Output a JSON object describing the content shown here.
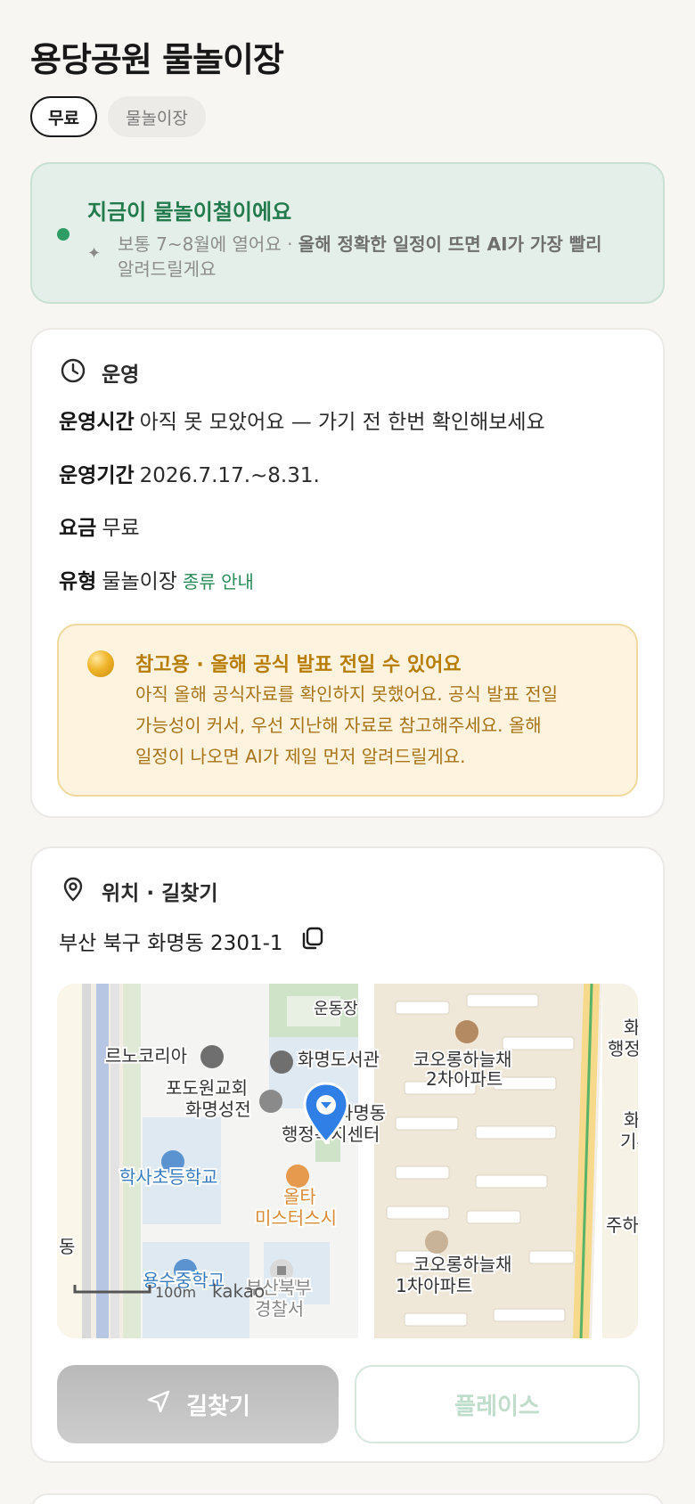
{
  "header": {
    "title": "용당공원 물놀이장"
  },
  "chips": [
    {
      "label": "무료",
      "active": true
    },
    {
      "label": "물놀이장",
      "active": false
    }
  ],
  "season_banner": {
    "headline": "지금이 물놀이철이에요",
    "desc_plain": "보통 7~8월에 열어요 · ",
    "desc_bold": "올해 정확한 일정이 뜨면 AI가 가장 빨리",
    "desc_tail": "알려드릴게요",
    "accent": "#2e9c64"
  },
  "operation": {
    "section_label": "운영",
    "icon": "clock-icon",
    "rows": [
      {
        "key": "운영시간",
        "value": "아직 못 모았어요 — 가기 전 한번 확인해보세요"
      },
      {
        "key": "운영기간",
        "value": "2026.7.17.~8.31."
      },
      {
        "key": "요금",
        "value": "무료"
      },
      {
        "key": "유형",
        "value": "물놀이장",
        "link": "종류 안내"
      }
    ],
    "notice": {
      "headline": "참고용 · 올해 공식 발표 전일 수 있어요",
      "line1": "아직 올해 공식자료를 확인하지 못했어요. 공식 발표 전일",
      "line2": "가능성이 커서, 우선 지난해 자료로 참고해주세요. 올해",
      "line3": "일정이 나오면 AI가 제일 먼저 알려드릴게요."
    }
  },
  "location": {
    "section_label": "위치 · 길찾기",
    "icon": "location-pin-icon",
    "address": "부산 북구 화명동 2301-1",
    "copy_icon": "copy-icon",
    "map": {
      "labels": {
        "playground": "운동장",
        "renault": "르노코리아",
        "library": "화명도서관",
        "church1": "포도원교회",
        "church2": "화명성전",
        "kolon2_a": "코오롱하늘채",
        "kolon2_b": "2차아파트",
        "office_a": "화명동",
        "office_b": "행정복지센터",
        "hak_school": "학사초등학교",
        "restaurant_a": "올타",
        "restaurant_b": "미스터스시",
        "yong_school": "용수중학교",
        "police_a": "북부",
        "police_b": "부산북부",
        "police_c": "경찰서",
        "kolon1_a": "코오롱하늘채",
        "kolon1_b": "1차아파트",
        "right_a": "화",
        "right_b": "행정",
        "right_c": "화",
        "right_d": "기부",
        "right_e": "주하",
        "left_edge": "동",
        "scale": "100m",
        "brand": "kakao"
      }
    },
    "buttons": {
      "route": "길찾기",
      "place": "플레이스"
    }
  }
}
